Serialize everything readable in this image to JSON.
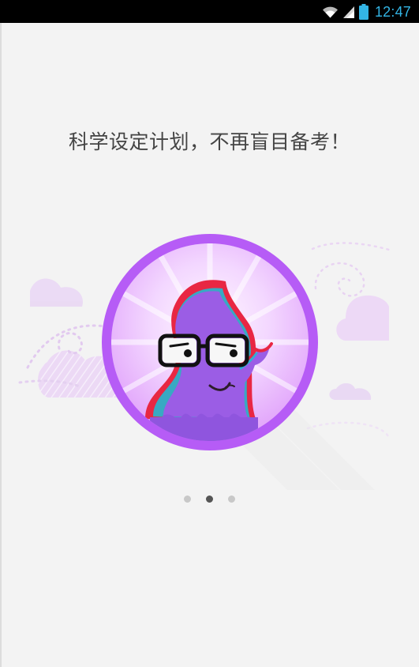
{
  "status_bar": {
    "time": "12:47",
    "icons": [
      "wifi-icon",
      "signal-icon",
      "battery-icon"
    ]
  },
  "main": {
    "headline": "科学设定计划，不再盲目备考！"
  },
  "pager": {
    "page_count": 3,
    "active_page": 2
  },
  "colors": {
    "accent": "#33b5e5",
    "background": "#f3f3f3",
    "ring": "#b65cf6",
    "octopus": "#9b5de5",
    "headline": "#444444",
    "dot_inactive": "#c8c8c8",
    "dot_active": "#555555"
  }
}
